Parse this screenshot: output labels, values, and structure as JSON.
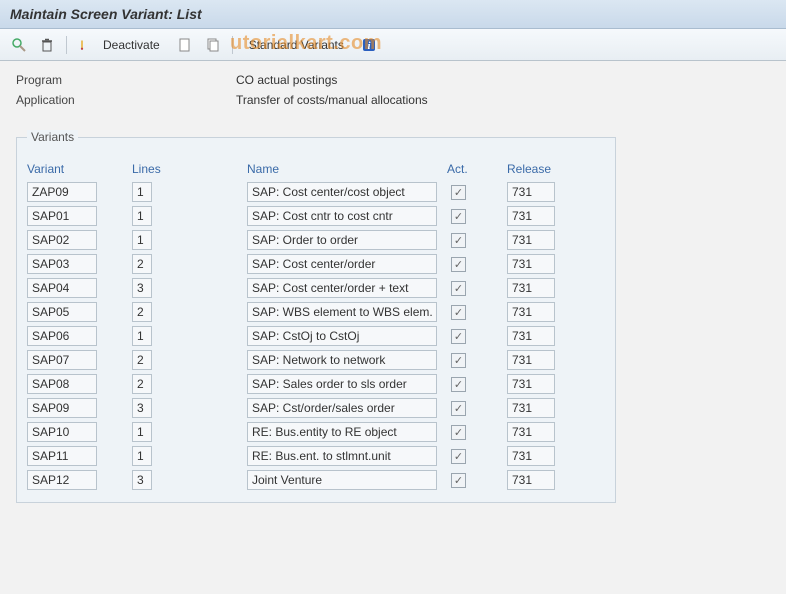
{
  "title": "Maintain Screen Variant: List",
  "toolbar": {
    "deactivate_label": "Deactivate",
    "stdvar_label": "Standard Variants"
  },
  "watermark": "utorialkart.com",
  "info": {
    "program_label": "Program",
    "program_value": "CO actual postings",
    "application_label": "Application",
    "application_value": "Transfer of costs/manual allocations"
  },
  "group": {
    "title": "Variants",
    "headers": {
      "variant": "Variant",
      "lines": "Lines",
      "name": "Name",
      "act": "Act.",
      "release": "Release"
    },
    "rows": [
      {
        "variant": "ZAP09",
        "lines": "1",
        "name": "SAP: Cost center/cost object",
        "act": true,
        "release": "731"
      },
      {
        "variant": "SAP01",
        "lines": "1",
        "name": "SAP: Cost cntr to cost cntr",
        "act": true,
        "release": "731"
      },
      {
        "variant": "SAP02",
        "lines": "1",
        "name": "SAP: Order to order",
        "act": true,
        "release": "731"
      },
      {
        "variant": "SAP03",
        "lines": "2",
        "name": "SAP: Cost center/order",
        "act": true,
        "release": "731"
      },
      {
        "variant": "SAP04",
        "lines": "3",
        "name": "SAP: Cost center/order + text",
        "act": true,
        "release": "731"
      },
      {
        "variant": "SAP05",
        "lines": "2",
        "name": "SAP: WBS element to WBS elem.",
        "act": true,
        "release": "731"
      },
      {
        "variant": "SAP06",
        "lines": "1",
        "name": "SAP: CstOj to CstOj",
        "act": true,
        "release": "731"
      },
      {
        "variant": "SAP07",
        "lines": "2",
        "name": "SAP: Network to network",
        "act": true,
        "release": "731"
      },
      {
        "variant": "SAP08",
        "lines": "2",
        "name": "SAP: Sales order to sls order",
        "act": true,
        "release": "731"
      },
      {
        "variant": "SAP09",
        "lines": "3",
        "name": "SAP: Cst/order/sales order",
        "act": true,
        "release": "731"
      },
      {
        "variant": "SAP10",
        "lines": "1",
        "name": "RE: Bus.entity to RE object",
        "act": true,
        "release": "731"
      },
      {
        "variant": "SAP11",
        "lines": "1",
        "name": "RE: Bus.ent. to stlmnt.unit",
        "act": true,
        "release": "731"
      },
      {
        "variant": "SAP12",
        "lines": "3",
        "name": "Joint Venture",
        "act": true,
        "release": "731"
      }
    ]
  }
}
